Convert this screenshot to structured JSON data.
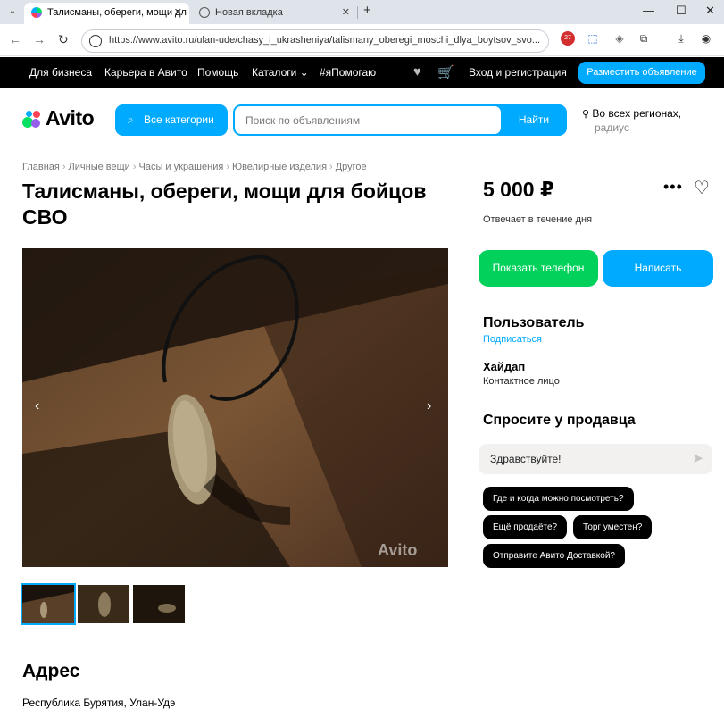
{
  "browser": {
    "tabs": [
      {
        "title": "Талисманы, обереги, мощи дл"
      },
      {
        "title": "Новая вкладка"
      }
    ],
    "url": "https://www.avito.ru/ulan-ude/chasy_i_ukrasheniya/talismany_oberegi_moschi_dlya_boytsov_svo...",
    "extension_badge": "27"
  },
  "topnav": {
    "links": [
      "Для бизнеса",
      "Карьера в Авито",
      "Помощь",
      "Каталоги",
      "#яПомогаю"
    ],
    "login": "Вход и регистрация",
    "post_ad": "Разместить объявление"
  },
  "header": {
    "logo": "Avito",
    "categories": "Все категории",
    "search_placeholder": "Поиск по объявлениям",
    "search_button": "Найти",
    "region": "Во всех регионах,",
    "region_sub": "радиус"
  },
  "breadcrumbs": [
    "Главная",
    "Личные вещи",
    "Часы и украшения",
    "Ювелирные изделия",
    "Другое"
  ],
  "listing": {
    "title": "Талисманы, обереги, мощи для бойцов СВО",
    "watermark": "Avito",
    "address_heading": "Адрес",
    "address": "Республика Бурятия, Улан-Удэ"
  },
  "sidebar": {
    "price": "5 000 ₽",
    "reply_time": "Отвечает в течение дня",
    "show_phone": "Показать телефон",
    "write": "Написать",
    "seller": "Пользователь",
    "subscribe": "Подписаться",
    "contact_name": "Хайдап",
    "contact_role": "Контактное лицо",
    "ask_heading": "Спросите у продавца",
    "ask_value": "Здравствуйте!",
    "quick_questions": [
      "Где и когда можно посмотреть?",
      "Ещё продаёте?",
      "Торг уместен?",
      "Отправите Авито Доставкой?"
    ]
  },
  "colors": {
    "brand_blue": "#00aaff",
    "brand_green": "#02d15c",
    "nav_black": "#000000"
  }
}
